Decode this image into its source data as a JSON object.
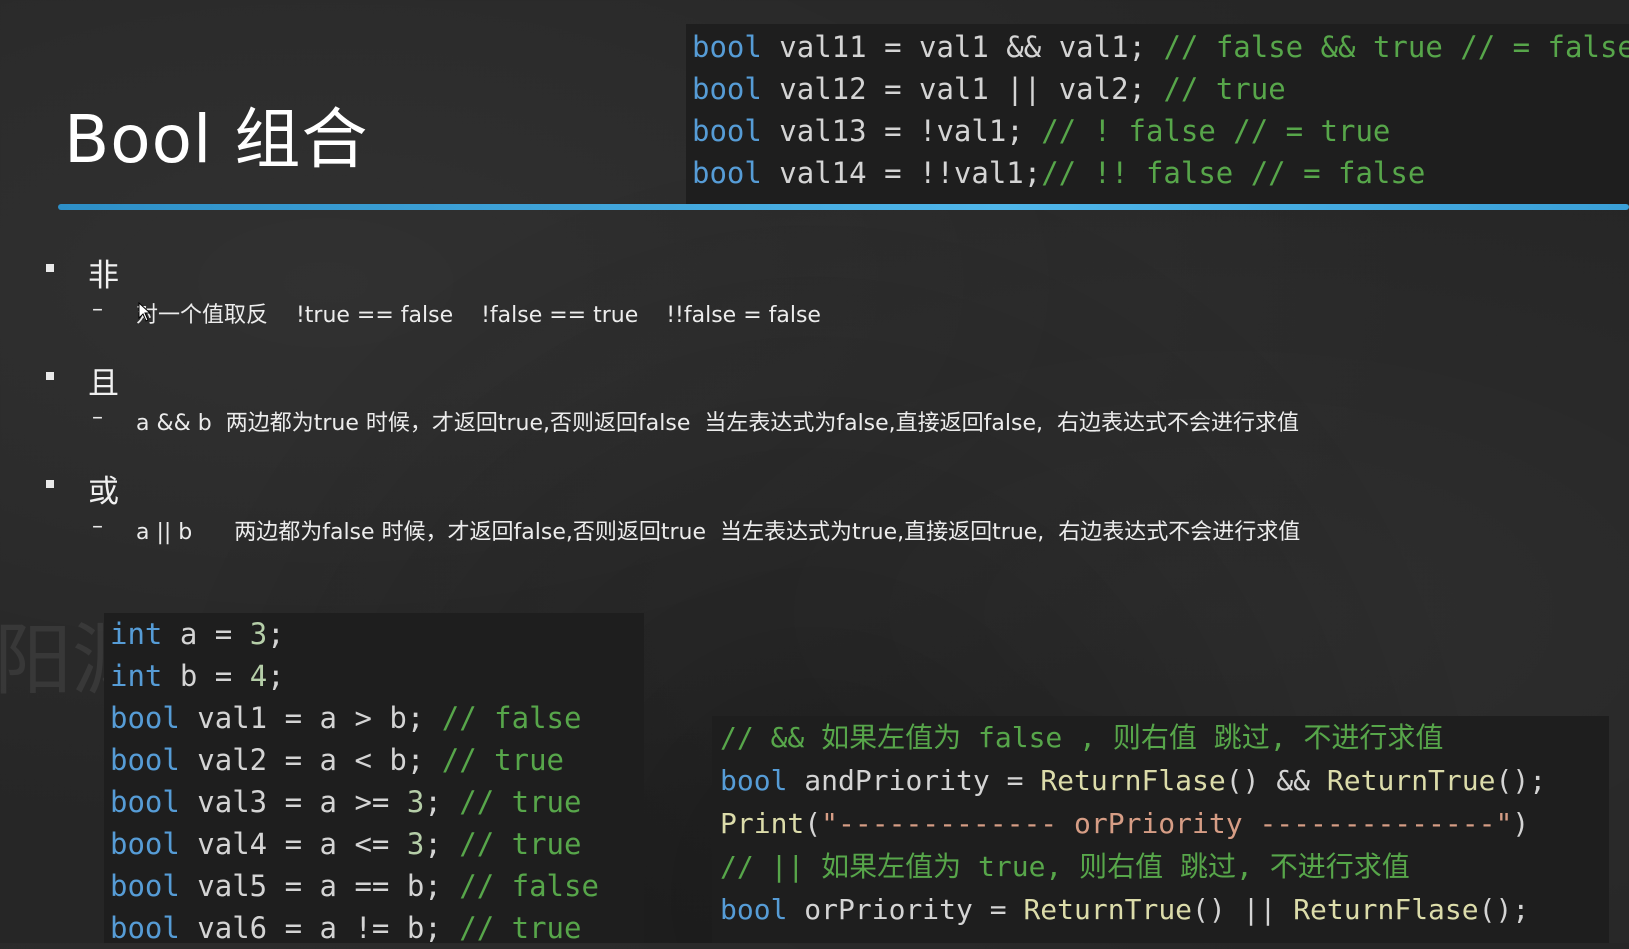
{
  "slide": {
    "title": "Bool 组合",
    "watermark": "阳渊游戏谭",
    "sections": [
      {
        "heading": "非",
        "description": "对一个值取反    !true == false    !false == true    !!false = false"
      },
      {
        "heading": "且",
        "description": "a && b  两边都为true 时候，才返回true,否则返回false  当左表达式为false,直接返回false,  右边表达式不会进行求值"
      },
      {
        "heading": "或",
        "description": "a || b      两边都为false 时候，才返回false,否则返回true  当左表达式为true,直接返回true,  右边表达式不会进行求值"
      }
    ]
  },
  "code_top": [
    [
      [
        "kw",
        "bool"
      ],
      [
        "id",
        " val11 "
      ],
      [
        "op",
        "= "
      ],
      [
        "id",
        "val1 "
      ],
      [
        "op",
        "&& "
      ],
      [
        "id",
        "val1; "
      ],
      [
        "cm",
        "// false && true // = false"
      ]
    ],
    [
      [
        "kw",
        "bool"
      ],
      [
        "id",
        " val12 "
      ],
      [
        "op",
        "= "
      ],
      [
        "id",
        "val1 "
      ],
      [
        "op",
        "|| "
      ],
      [
        "id",
        "val2; "
      ],
      [
        "cm",
        "// true"
      ]
    ],
    [
      [
        "kw",
        "bool"
      ],
      [
        "id",
        " val13 "
      ],
      [
        "op",
        "= "
      ],
      [
        "id",
        "!val1; "
      ],
      [
        "cm",
        "// ! false // = true"
      ]
    ],
    [
      [
        "kw",
        "bool"
      ],
      [
        "id",
        " val14 "
      ],
      [
        "op",
        "= "
      ],
      [
        "id",
        "!!val1;"
      ],
      [
        "cm",
        "// !! false // = false"
      ]
    ]
  ],
  "code_bottom_left": [
    [
      [
        "kw",
        "int"
      ],
      [
        "id",
        " a "
      ],
      [
        "op",
        "= "
      ],
      [
        "num",
        "3"
      ],
      [
        "op",
        ";"
      ]
    ],
    [
      [
        "kw",
        "int"
      ],
      [
        "id",
        " b "
      ],
      [
        "op",
        "= "
      ],
      [
        "num",
        "4"
      ],
      [
        "op",
        ";"
      ]
    ],
    [
      [
        "kw",
        "bool"
      ],
      [
        "id",
        " val1 "
      ],
      [
        "op",
        "= "
      ],
      [
        "id",
        "a "
      ],
      [
        "op",
        "> "
      ],
      [
        "id",
        "b; "
      ],
      [
        "cm",
        "// false"
      ]
    ],
    [
      [
        "kw",
        "bool"
      ],
      [
        "id",
        " val2 "
      ],
      [
        "op",
        "= "
      ],
      [
        "id",
        "a "
      ],
      [
        "op",
        "< "
      ],
      [
        "id",
        "b; "
      ],
      [
        "cm",
        "// true"
      ]
    ],
    [
      [
        "kw",
        "bool"
      ],
      [
        "id",
        " val3 "
      ],
      [
        "op",
        "= "
      ],
      [
        "id",
        "a "
      ],
      [
        "op",
        ">= "
      ],
      [
        "num",
        "3"
      ],
      [
        "op",
        "; "
      ],
      [
        "cm",
        "// true"
      ]
    ],
    [
      [
        "kw",
        "bool"
      ],
      [
        "id",
        " val4 "
      ],
      [
        "op",
        "= "
      ],
      [
        "id",
        "a "
      ],
      [
        "op",
        "<= "
      ],
      [
        "num",
        "3"
      ],
      [
        "op",
        "; "
      ],
      [
        "cm",
        "// true"
      ]
    ],
    [
      [
        "kw",
        "bool"
      ],
      [
        "id",
        " val5 "
      ],
      [
        "op",
        "= "
      ],
      [
        "id",
        "a "
      ],
      [
        "op",
        "== "
      ],
      [
        "id",
        "b; "
      ],
      [
        "cm",
        "// false"
      ]
    ],
    [
      [
        "kw",
        "bool"
      ],
      [
        "id",
        " val6 "
      ],
      [
        "op",
        "= "
      ],
      [
        "id",
        "a "
      ],
      [
        "op",
        "!= "
      ],
      [
        "id",
        "b; "
      ],
      [
        "cm",
        "// true"
      ]
    ]
  ],
  "code_bottom_right": [
    [
      [
        "cm",
        "// && 如果左值为 false , 则右值 跳过, 不进行求值"
      ]
    ],
    [
      [
        "kw",
        "bool"
      ],
      [
        "id",
        " andPriority "
      ],
      [
        "op",
        "= "
      ],
      [
        "fn",
        "ReturnFlase"
      ],
      [
        "op",
        "() && "
      ],
      [
        "fn",
        "ReturnTrue"
      ],
      [
        "op",
        "();"
      ]
    ],
    [
      [
        "fn",
        "Print"
      ],
      [
        "op",
        "("
      ],
      [
        "str",
        "\"------------- orPriority --------------\""
      ],
      [
        "op",
        ")"
      ]
    ],
    [
      [
        "cm",
        "// || 如果左值为 true, 则右值 跳过, 不进行求值"
      ]
    ],
    [
      [
        "kw",
        "bool"
      ],
      [
        "id",
        " orPriority "
      ],
      [
        "op",
        "= "
      ],
      [
        "fn",
        "ReturnTrue"
      ],
      [
        "op",
        "() || "
      ],
      [
        "fn",
        "ReturnFlase"
      ],
      [
        "op",
        "();"
      ]
    ]
  ]
}
